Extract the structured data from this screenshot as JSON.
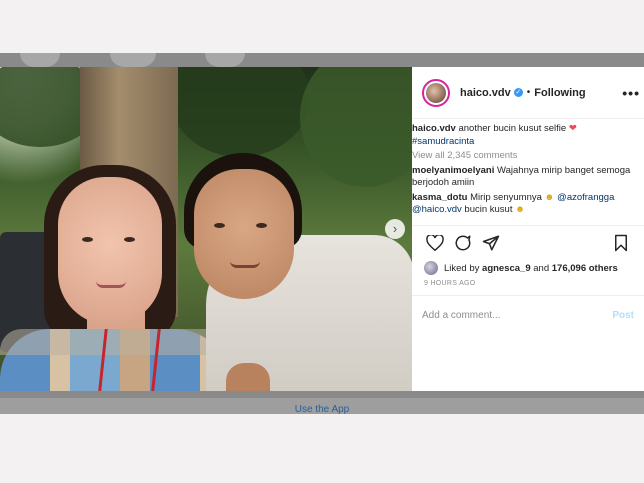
{
  "post": {
    "username": "haico.vdv",
    "following_label": "Following",
    "bullet": "•",
    "more_label": "•••",
    "caption_text": "another bucin kusut selfie",
    "hashtag": "#samudracinta",
    "view_all": "View all 2,345 comments",
    "comments": [
      {
        "user": "moelyanimoelyani",
        "text": "Wajahnya mirip banget semoga berjodoh amiin"
      },
      {
        "user": "kasma_dotu",
        "text_before": "Mirip senyumnya",
        "mention1": "@azofrangga",
        "mention2": "@haico.vdv",
        "text_after": "bucin kusut"
      }
    ],
    "liked_by_prefix": "Liked by",
    "liked_by_user": "agnesca_9",
    "liked_by_mid": "and",
    "liked_by_count": "176,096 others",
    "time_ago": "9 HOURS AGO",
    "add_comment_placeholder": "Add a comment...",
    "post_label": "Post"
  },
  "footer": {
    "use_app": "Use the App"
  },
  "colors": {
    "accent": "#3897f0",
    "link": "#00376b",
    "heart": "#ed4956"
  },
  "icons": [
    "verified-badge-icon",
    "heart-icon",
    "comment-icon",
    "share-icon",
    "bookmark-icon",
    "chevron-right-icon",
    "user-tag-icon"
  ]
}
